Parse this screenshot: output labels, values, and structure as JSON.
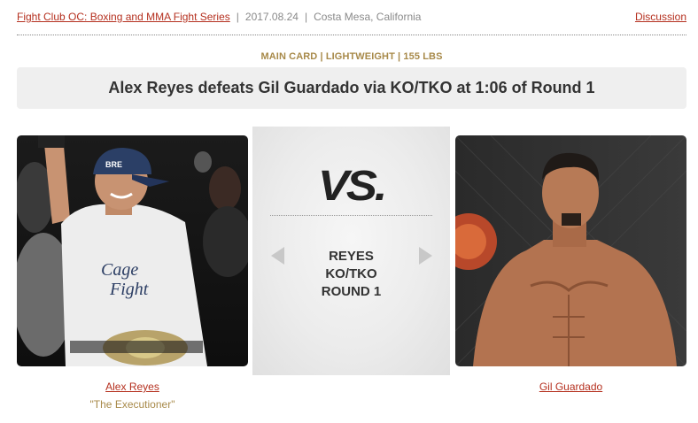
{
  "header": {
    "event_name": "Fight Club OC: Boxing and MMA Fight Series",
    "date": "2017.08.24",
    "location": "Costa Mesa, California",
    "discussion_label": "Discussion",
    "separator": "|"
  },
  "fight": {
    "info": "MAIN CARD | LIGHTWEIGHT | 155 LBS",
    "result_headline": "Alex Reyes defeats Gil Guardado via KO/TKO at 1:06 of Round 1"
  },
  "vs_panel": {
    "vs_label": "VS.",
    "winner": "REYES",
    "method": "KO/TKO",
    "round": "ROUND 1",
    "prev_icon": "triangle-left-icon",
    "next_icon": "triangle-right-icon"
  },
  "fighters": {
    "left": {
      "name": "Alex Reyes",
      "nickname": "\"The Executioner\""
    },
    "right": {
      "name": "Gil Guardado"
    }
  },
  "colors": {
    "link": "#b5301f",
    "gold": "#a88a4a",
    "result_bg": "#efefef"
  }
}
